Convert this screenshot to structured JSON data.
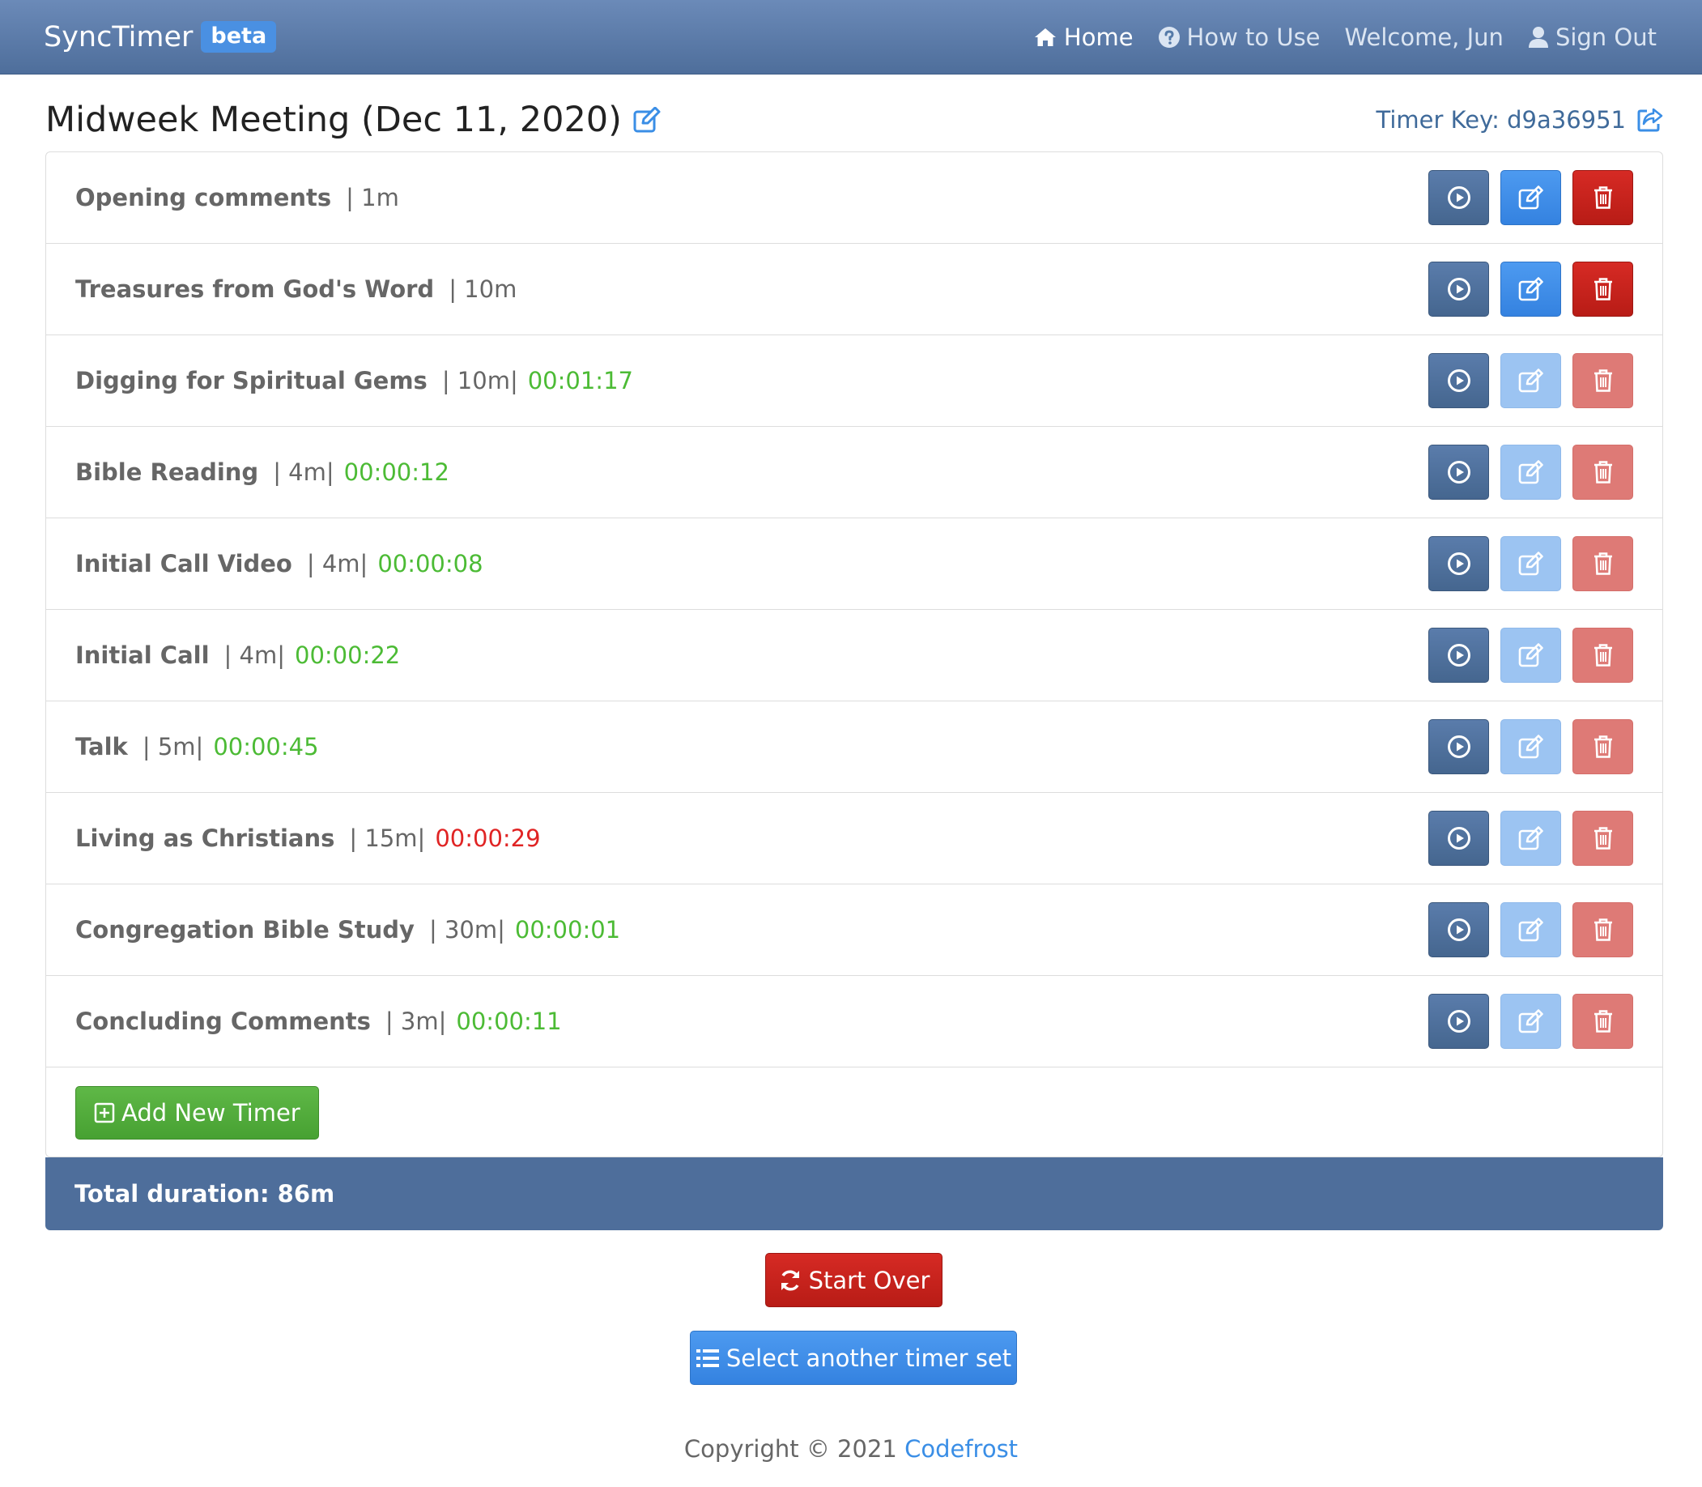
{
  "navbar": {
    "brand": "SyncTimer",
    "badge": "beta",
    "links": {
      "home": "Home",
      "how_to_use": "How to Use",
      "welcome": "Welcome, Jun",
      "sign_out": "Sign Out"
    }
  },
  "header": {
    "title": "Midweek Meeting (Dec 11, 2020)",
    "timer_key": "Timer Key: d9a36951"
  },
  "timers": [
    {
      "name": "Opening comments",
      "duration": "| 1m",
      "elapsed": "",
      "status": "none",
      "actions_enabled": true
    },
    {
      "name": "Treasures from God's Word",
      "duration": "| 10m",
      "elapsed": "",
      "status": "none",
      "actions_enabled": true
    },
    {
      "name": "Digging for Spiritual Gems",
      "duration": "| 10m|",
      "elapsed": "00:01:17",
      "status": "ok",
      "actions_enabled": false
    },
    {
      "name": "Bible Reading",
      "duration": "| 4m|",
      "elapsed": "00:00:12",
      "status": "ok",
      "actions_enabled": false
    },
    {
      "name": "Initial Call Video",
      "duration": "| 4m|",
      "elapsed": "00:00:08",
      "status": "ok",
      "actions_enabled": false
    },
    {
      "name": "Initial Call",
      "duration": "| 4m|",
      "elapsed": "00:00:22",
      "status": "ok",
      "actions_enabled": false
    },
    {
      "name": "Talk",
      "duration": "| 5m|",
      "elapsed": "00:00:45",
      "status": "ok",
      "actions_enabled": false
    },
    {
      "name": "Living as Christians",
      "duration": "| 15m|",
      "elapsed": "00:00:29",
      "status": "over",
      "actions_enabled": false
    },
    {
      "name": "Congregation Bible Study",
      "duration": "| 30m|",
      "elapsed": "00:00:01",
      "status": "ok",
      "actions_enabled": false
    },
    {
      "name": "Concluding Comments",
      "duration": "| 3m|",
      "elapsed": "00:00:11",
      "status": "ok",
      "actions_enabled": false
    }
  ],
  "add_timer_label": "Add New Timer",
  "total": "Total duration: 86m",
  "buttons": {
    "start_over": "Start Over",
    "select_set": "Select another timer set"
  },
  "footer": {
    "copyright": "Copyright © 2021",
    "company": "Codefrost"
  },
  "colors": {
    "navbar": "#4e6e9b",
    "elapsed_ok": "#4cbb35",
    "elapsed_over": "#e02424",
    "play": "#4e6e9b",
    "edit": "#3a8ee6",
    "delete": "#c4201a",
    "add": "#52ac3c"
  },
  "icons": {
    "play": "play-circle-icon",
    "edit": "edit-icon",
    "delete": "trash-icon",
    "add": "plus-square-icon",
    "refresh": "refresh-icon",
    "list": "list-icon",
    "home": "home-icon",
    "help": "question-circle-icon",
    "user": "user-icon",
    "share": "share-icon"
  }
}
